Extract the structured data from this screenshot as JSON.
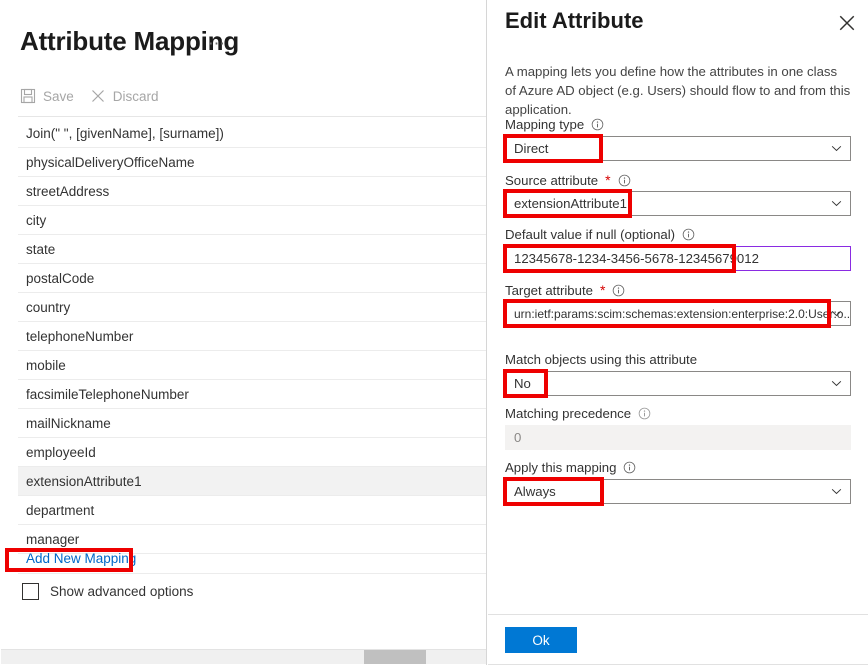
{
  "left": {
    "title": "Attribute Mapping",
    "ellipsis": "⋯",
    "toolbar": {
      "save_label": "Save",
      "discard_label": "Discard"
    },
    "attributes": [
      {
        "label": "Join(\" \", [givenName], [surname])",
        "selected": false
      },
      {
        "label": "physicalDeliveryOfficeName",
        "selected": false
      },
      {
        "label": "streetAddress",
        "selected": false
      },
      {
        "label": "city",
        "selected": false
      },
      {
        "label": "state",
        "selected": false
      },
      {
        "label": "postalCode",
        "selected": false
      },
      {
        "label": "country",
        "selected": false
      },
      {
        "label": "telephoneNumber",
        "selected": false
      },
      {
        "label": "mobile",
        "selected": false
      },
      {
        "label": "facsimileTelephoneNumber",
        "selected": false
      },
      {
        "label": "mailNickname",
        "selected": false
      },
      {
        "label": "employeeId",
        "selected": false
      },
      {
        "label": "extensionAttribute1",
        "selected": true
      },
      {
        "label": "department",
        "selected": false
      },
      {
        "label": "manager",
        "selected": false
      }
    ],
    "add_mapping_link": "Add New Mapping",
    "advanced_options_label": "Show advanced options",
    "advanced_options_checked": false
  },
  "panel": {
    "title": "Edit Attribute",
    "description": "A mapping lets you define how the attributes in one class of Azure AD object (e.g. Users) should flow to and from this application.",
    "fields": {
      "mapping_type": {
        "label": "Mapping type",
        "value": "Direct",
        "required": false,
        "highlighted": true
      },
      "source_attribute": {
        "label": "Source attribute",
        "value": "extensionAttribute1",
        "required": true,
        "highlighted": true
      },
      "default_value": {
        "label": "Default value if null (optional)",
        "value": "12345678-1234-3456-5678-12345679012",
        "required": false,
        "highlighted": true
      },
      "target_attribute": {
        "label": "Target attribute",
        "value": "urn:ietf:params:scim:schemas:extension:enterprise:2.0:User:o...",
        "required": true,
        "highlighted": true
      },
      "match_objects": {
        "label": "Match objects using this attribute",
        "value": "No",
        "required": false,
        "highlighted": true
      },
      "matching_precedence": {
        "label": "Matching precedence",
        "value": "0",
        "required": false,
        "disabled": true
      },
      "apply_mapping": {
        "label": "Apply this mapping",
        "value": "Always",
        "required": false,
        "highlighted": true
      }
    },
    "ok_label": "Ok"
  },
  "colors": {
    "accent_blue": "#0078d4",
    "link_blue": "#0068c8",
    "annotation_red": "#ee0000",
    "focus_purple": "#8a2be2",
    "selected_row": "#f2f2f2"
  }
}
